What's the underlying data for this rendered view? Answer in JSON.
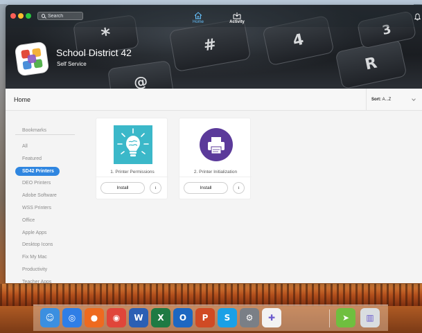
{
  "window": {
    "search_placeholder": "Search",
    "nav": {
      "home_label": "Home",
      "activity_label": "Activity"
    }
  },
  "brand": {
    "title": "School District 42",
    "subtitle": "Self Service"
  },
  "banner_keys": [
    "*",
    "#",
    "3",
    "R",
    "@",
    "4"
  ],
  "page": {
    "title": "Home",
    "sort_label": "Sort:",
    "sort_value": "A...Z"
  },
  "sidebar": {
    "bookmarks_label": "Bookmarks",
    "items": [
      {
        "label": "All"
      },
      {
        "label": "Featured"
      },
      {
        "label": "SD42 Printers",
        "active": true
      },
      {
        "label": "DEO Printers"
      },
      {
        "label": "Adobe Software"
      },
      {
        "label": "WSS Printers"
      },
      {
        "label": "Office"
      },
      {
        "label": "Apple Apps"
      },
      {
        "label": "Desktop Icons"
      },
      {
        "label": "Fix My Mac"
      },
      {
        "label": "Productivity"
      },
      {
        "label": "Teacher Apps"
      }
    ]
  },
  "cards": [
    {
      "name": "1. Printer Permissions",
      "install_label": "Install",
      "info_label": "i",
      "icon": "lightbulb-brain-icon",
      "icon_bg": "#3bb8c9"
    },
    {
      "name": "2. Printer Initialization",
      "install_label": "Install",
      "info_label": "i",
      "icon": "printer-icon",
      "icon_bg": "#5b3a9a"
    }
  ],
  "dock": {
    "apps": [
      {
        "name": "finder-icon",
        "color": "#3b8fe0",
        "glyph": "☺"
      },
      {
        "name": "safari-icon",
        "color": "#2f7ee6",
        "glyph": "◎"
      },
      {
        "name": "firefox-icon",
        "color": "#ee6a1f",
        "glyph": "●"
      },
      {
        "name": "chrome-icon",
        "color": "#e0453a",
        "glyph": "◉"
      },
      {
        "name": "word-icon",
        "color": "#2b5fb4",
        "glyph": "W"
      },
      {
        "name": "excel-icon",
        "color": "#1e7a43",
        "glyph": "X"
      },
      {
        "name": "outlook-icon",
        "color": "#1d67c1",
        "glyph": "O"
      },
      {
        "name": "powerpoint-icon",
        "color": "#d04a24",
        "glyph": "P"
      },
      {
        "name": "skype-icon",
        "color": "#1aa0e6",
        "glyph": "S"
      },
      {
        "name": "system-preferences-icon",
        "color": "#7a7f86",
        "glyph": "⚙"
      },
      {
        "name": "self-service-icon",
        "color": "#f2f2f2",
        "glyph": "✚"
      },
      {
        "name": "maps-app-icon",
        "color": "#6fbf3f",
        "glyph": "➤"
      },
      {
        "name": "trash-icon",
        "color": "#d9dde0",
        "glyph": "▥"
      }
    ]
  },
  "colors": {
    "accent": "#2f86e0",
    "home_tab": "#66c2ff",
    "bell": "#ffffff"
  }
}
